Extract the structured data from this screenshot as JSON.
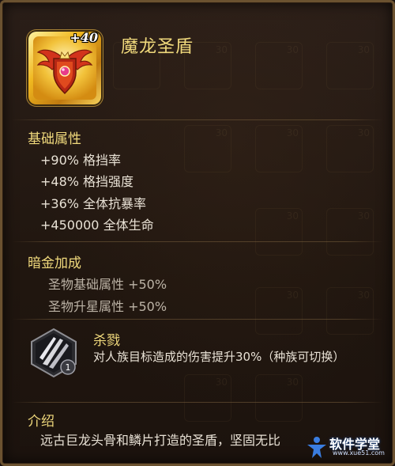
{
  "item": {
    "name": "魔龙圣盾",
    "level": "+40",
    "icon": "golden-winged-shield-icon",
    "frame_color": "#f0b820"
  },
  "base_attributes": {
    "title": "基础属性",
    "lines": [
      "+90% 格挡率",
      "+48% 格挡强度",
      "+36% 全体抗暴率",
      "+450000 全体生命"
    ]
  },
  "dark_gold": {
    "title": "暗金加成",
    "lines": [
      "圣物基础属性 +50%",
      "圣物升星属性 +50%"
    ]
  },
  "skill": {
    "name": "杀戮",
    "level": "1",
    "icon": "slash-claw-skill-icon",
    "desc": "对人族目标造成的伤害提升30%（种族可切换）"
  },
  "intro": {
    "title": "介绍",
    "text": "远古巨龙头骨和鳞片打造的圣盾，坚固无比"
  },
  "watermark": {
    "text": "软件学堂",
    "sub": "www.xue51.com",
    "icon": "person-logo-icon"
  },
  "colors": {
    "gold_text": "#f0d97c",
    "body_text": "#e9e2d6",
    "border": "#6b5230",
    "background": "#20160f"
  }
}
